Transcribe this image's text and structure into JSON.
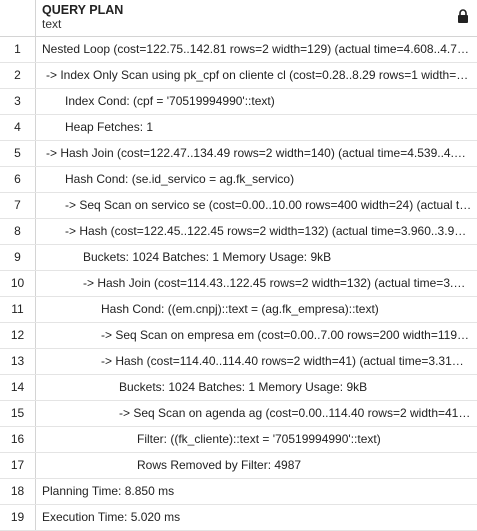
{
  "header": {
    "column_name": "QUERY PLAN",
    "column_type": "text",
    "lock_icon": "lock-icon"
  },
  "rows": [
    {
      "n": "1",
      "indent": 0,
      "text": "Nested Loop  (cost=122.75..142.81 rows=2 width=129) (actual time=4.608..4.7…"
    },
    {
      "n": "2",
      "indent": 1,
      "text": "->  Index Only Scan using pk_cpf on cliente cl  (cost=0.28..8.29 rows=1 width=…"
    },
    {
      "n": "3",
      "indent": 2,
      "text": "Index Cond: (cpf = '70519994990'::text)"
    },
    {
      "n": "4",
      "indent": 2,
      "text": "Heap Fetches: 1"
    },
    {
      "n": "5",
      "indent": 1,
      "text": "->  Hash Join  (cost=122.47..134.49 rows=2 width=140) (actual time=4.539..4.…"
    },
    {
      "n": "6",
      "indent": 2,
      "text": "Hash Cond: (se.id_servico = ag.fk_servico)"
    },
    {
      "n": "7",
      "indent": 3,
      "text": "->  Seq Scan on servico se  (cost=0.00..10.00 rows=400 width=24) (actual t…"
    },
    {
      "n": "8",
      "indent": 3,
      "text": "->  Hash  (cost=122.45..122.45 rows=2 width=132) (actual time=3.960..3.9…"
    },
    {
      "n": "9",
      "indent": 4,
      "text": "Buckets: 1024  Batches: 1  Memory Usage: 9kB"
    },
    {
      "n": "10",
      "indent": 5,
      "text": "->  Hash Join  (cost=114.43..122.45 rows=2 width=132) (actual time=3.…"
    },
    {
      "n": "11",
      "indent": 6,
      "text": "Hash Cond: ((em.cnpj)::text = (ag.fk_empresa)::text)"
    },
    {
      "n": "12",
      "indent": 7,
      "text": "->  Seq Scan on empresa em  (cost=0.00..7.00 rows=200 width=119…"
    },
    {
      "n": "13",
      "indent": 7,
      "text": "->  Hash  (cost=114.40..114.40 rows=2 width=41) (actual time=3.31…"
    },
    {
      "n": "14",
      "indent": 8,
      "text": "Buckets: 1024  Batches: 1  Memory Usage: 9kB"
    },
    {
      "n": "15",
      "indent": 9,
      "text": "->  Seq Scan on agenda ag  (cost=0.00..114.40 rows=2 width=41…"
    },
    {
      "n": "16",
      "indent": 10,
      "text": "Filter: ((fk_cliente)::text = '70519994990'::text)"
    },
    {
      "n": "17",
      "indent": 10,
      "text": "Rows Removed by Filter: 4987"
    },
    {
      "n": "18",
      "indent": 0,
      "text": "Planning Time: 8.850 ms"
    },
    {
      "n": "19",
      "indent": 0,
      "text": "Execution Time: 5.020 ms"
    }
  ]
}
